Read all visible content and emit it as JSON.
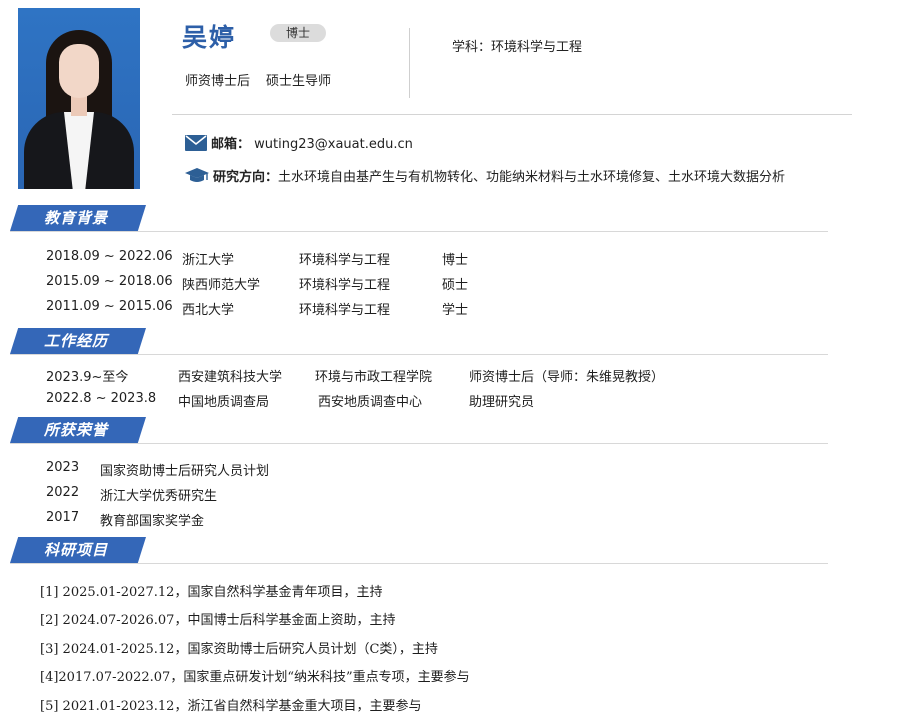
{
  "profile": {
    "name": "吴婷",
    "degree": "博士",
    "titles": [
      "师资博士后",
      "硕士生导师"
    ],
    "subject": "学科：环境科学与工程",
    "email_label": "邮箱：",
    "email": "wuting23@xauat.edu.cn",
    "research_label": "研究方向：",
    "research": "土水环境自由基产生与有机物转化、功能纳米材料与土水环境修复、土水环境大数据分析"
  },
  "icons": {
    "email": "envelope-icon",
    "research": "graduation-cap-icon"
  },
  "colors": {
    "accent": "#3467b8",
    "name": "#2d5fa8",
    "badge": "#dcdcdc"
  },
  "sections": {
    "education": "教育背景",
    "work": "工作经历",
    "honors": "所获荣誉",
    "projects": "科研项目"
  },
  "education": [
    {
      "period": "2018.09 ~ 2022.06",
      "school": "浙江大学",
      "major": "环境科学与工程",
      "degree": "博士"
    },
    {
      "period": "2015.09 ~ 2018.06",
      "school": "陕西师范大学",
      "major": "环境科学与工程",
      "degree": "硕士"
    },
    {
      "period": "2011.09 ~ 2015.06",
      "school": "西北大学",
      "major": "环境科学与工程",
      "degree": "学士"
    }
  ],
  "work": [
    {
      "period": "2023.9~至今",
      "org": "西安建筑科技大学",
      "dept": "环境与市政工程学院",
      "role": "师资博士后（导师：朱维晃教授）"
    },
    {
      "period": "2022.8 ~ 2023.8",
      "org": "中国地质调查局",
      "dept": "西安地质调查中心",
      "role": "助理研究员"
    }
  ],
  "honors": [
    {
      "year": "2023",
      "title": "国家资助博士后研究人员计划"
    },
    {
      "year": "2022",
      "title": "浙江大学优秀研究生"
    },
    {
      "year": "2017",
      "title": "教育部国家奖学金"
    }
  ],
  "projects": [
    "[1] 2025.01-2027.12，国家自然科学基金青年项目，主持",
    "[2] 2024.07-2026.07，中国博士后科学基金面上资助，主持",
    "[3] 2024.01-2025.12，国家资助博士后研究人员计划（C类），主持",
    "[4]2017.07-2022.07，国家重点研发计划“纳米科技”重点专项，主要参与",
    "[5] 2021.01-2023.12，浙江省自然科学基金重大项目，主要参与"
  ]
}
